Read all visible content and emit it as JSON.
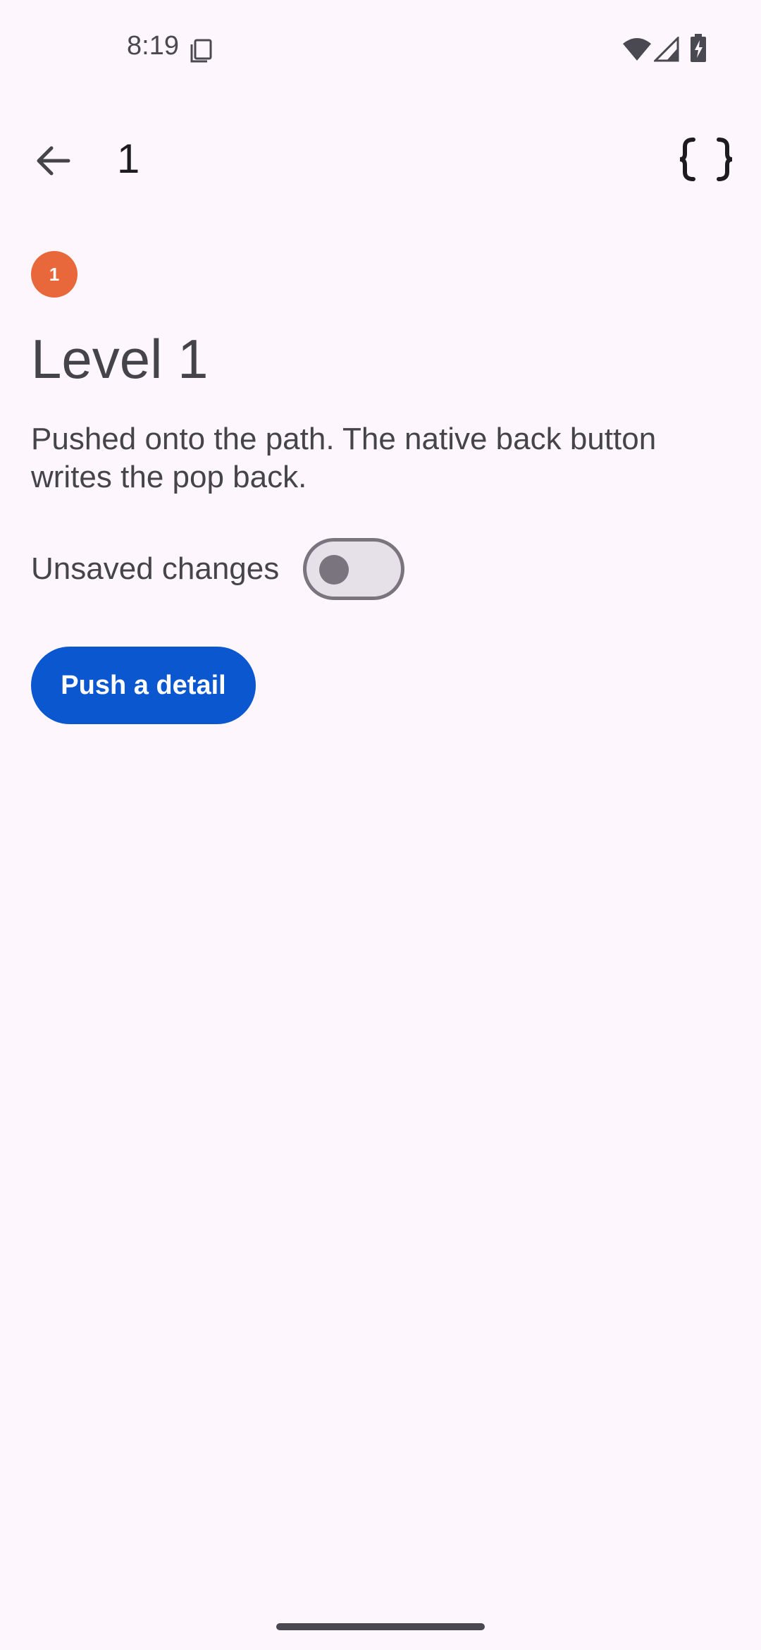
{
  "status_bar": {
    "time": "8:19",
    "icons": [
      "sim-card-icon",
      "wifi-icon",
      "cell-signal-icon",
      "battery-charging-icon"
    ]
  },
  "app_bar": {
    "back_icon": "arrow-back-icon",
    "title": "1",
    "action_icon": "curly-braces-icon"
  },
  "content": {
    "badge": "1",
    "badge_color": "#e8673b",
    "heading": "Level 1",
    "description": "Pushed onto the path. The native back button writes the pop back.",
    "toggle": {
      "label": "Unsaved changes",
      "checked": false
    },
    "primary_button": {
      "label": "Push a detail",
      "color": "#0b57d0"
    }
  },
  "colors": {
    "background": "#fdf7fd",
    "text_secondary": "#46444b"
  }
}
